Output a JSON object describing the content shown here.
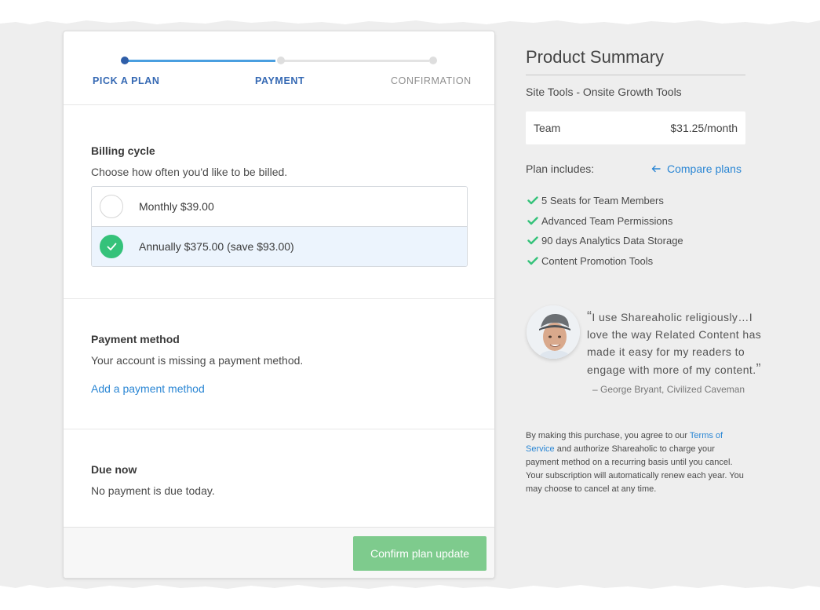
{
  "stepper": {
    "steps": [
      {
        "label": "PICK A PLAN",
        "state": "complete"
      },
      {
        "label": "PAYMENT",
        "state": "current"
      },
      {
        "label": "CONFIRMATION",
        "state": "pending"
      }
    ]
  },
  "billing": {
    "title": "Billing cycle",
    "subtitle": "Choose how often you'd like to be billed.",
    "options": [
      {
        "label": "Monthly $39.00",
        "selected": false
      },
      {
        "label": "Annually $375.00 (save $93.00)",
        "selected": true
      }
    ]
  },
  "payment": {
    "title": "Payment method",
    "subtitle": "Your account is missing a payment method.",
    "add_link": "Add a payment method"
  },
  "due": {
    "title": "Due now",
    "subtitle": "No payment is due today."
  },
  "footer": {
    "confirm_label": "Confirm plan update"
  },
  "summary": {
    "title": "Product Summary",
    "product": "Site Tools - Onsite Growth Tools",
    "plan_name": "Team",
    "plan_price": "$31.25/month",
    "includes_label": "Plan includes:",
    "compare_label": "Compare plans",
    "features": [
      "5 Seats for Team Members",
      "Advanced Team Permissions",
      "90 days Analytics Data Storage",
      "Content Promotion Tools"
    ]
  },
  "testimonial": {
    "open_mark": "“",
    "text": "I use Shareaholic religiously…I love the way Related Content has made it easy for my readers to engage with more of my content.",
    "close_mark": "”",
    "author": "– George Bryant, Civilized Caveman"
  },
  "legal": {
    "before": "By making this purchase, you agree to our ",
    "terms_link": "Terms of Service",
    "after": " and authorize Shareaholic to charge your payment method on a recurring basis until you cancel. Your subscription will automatically renew each year. You may choose to cancel at any time."
  },
  "colors": {
    "accent_blue": "#2a86d4",
    "step_active": "#2f5ea8",
    "success_green": "#35c27a",
    "button_green": "#7ecb8d",
    "background_grey": "#eeeeee"
  },
  "icons": {
    "feature_bullet": "check-icon",
    "compare_arrow": "arrow-left-icon",
    "selected_radio": "check-icon"
  }
}
